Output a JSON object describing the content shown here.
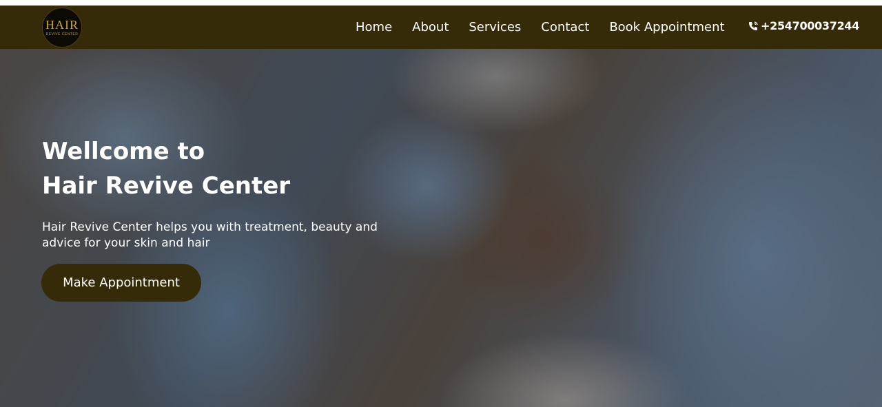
{
  "logo": {
    "text": "HAIR",
    "sub": "REVIVE CENTER"
  },
  "nav": {
    "items": [
      "Home",
      "About",
      "Services",
      "Contact",
      "Book Appointment"
    ]
  },
  "phone": {
    "icon": "phone-icon",
    "number": "+254700037244"
  },
  "hero": {
    "title_line1": "Wellcome to",
    "title_line2": "Hair Revive Center",
    "description": "Hair Revive Center helps you with treatment, beauty and advice for your skin and hair",
    "cta_label": "Make Appointment"
  },
  "colors": {
    "brand": "#362b09",
    "text": "#ffffff"
  }
}
